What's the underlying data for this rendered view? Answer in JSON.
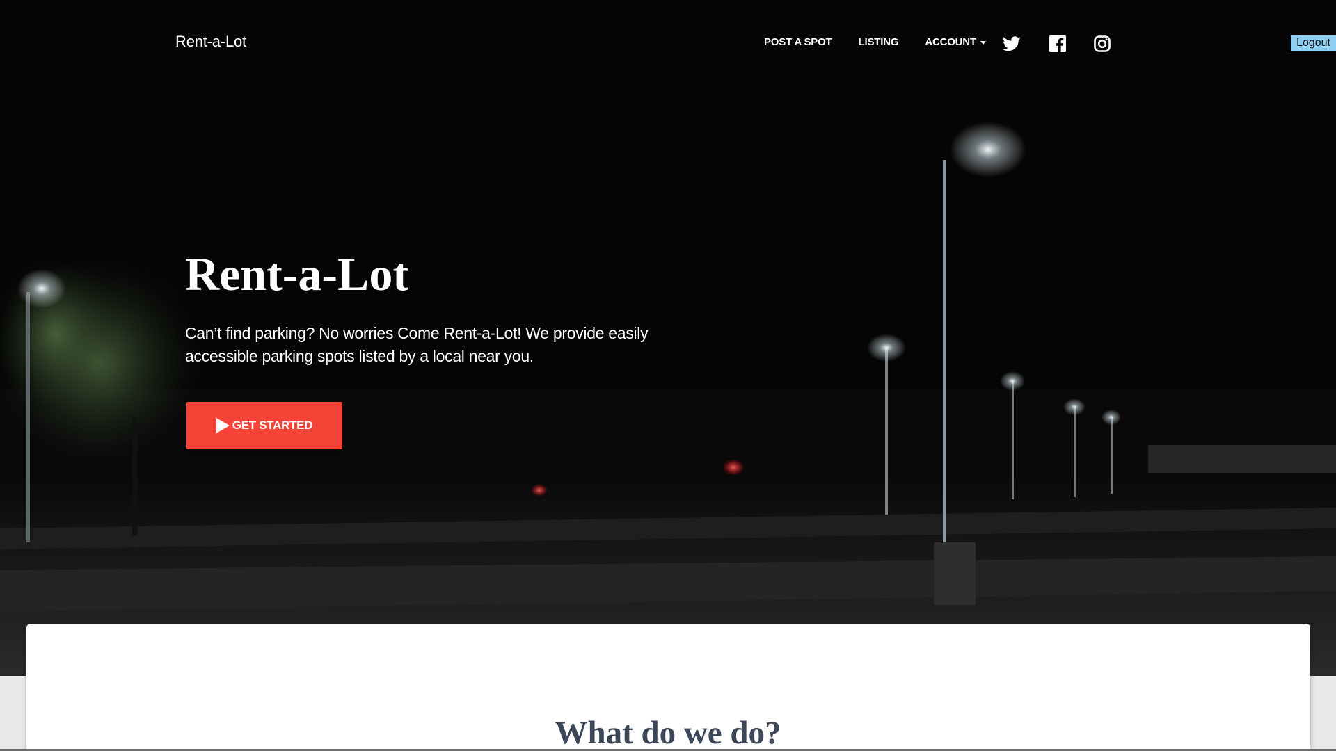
{
  "nav": {
    "brand": "Rent-a-Lot",
    "links": [
      {
        "label": "POST A SPOT"
      },
      {
        "label": "LISTING"
      },
      {
        "label": "ACCOUNT"
      }
    ],
    "social_icons": [
      "twitter-icon",
      "facebook-icon",
      "instagram-icon"
    ],
    "logout_label": "Logout"
  },
  "hero": {
    "title": "Rent-a-Lot",
    "description": "Can’t find parking? No worries Come Rent-a-Lot! We provide easily accessible parking spots listed by a local near you.",
    "cta_label": "GET STARTED",
    "background": "night parking lot with street lamps"
  },
  "section": {
    "title": "What do we do?"
  },
  "colors": {
    "cta": "#f44336",
    "logout_bg": "#8fcff3",
    "section_title": "#3c4858"
  }
}
